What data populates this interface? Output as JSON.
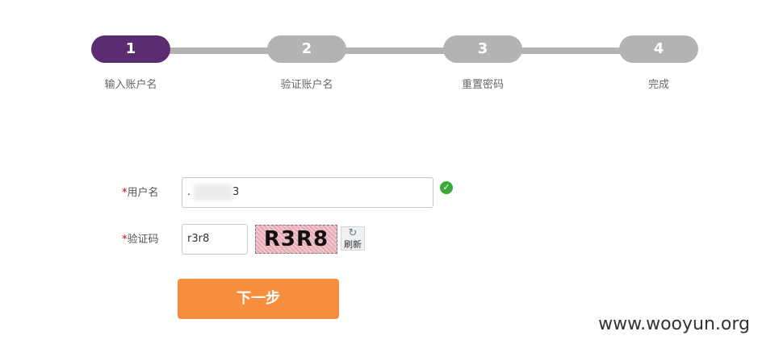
{
  "steps": [
    {
      "number": "1",
      "label": "输入账户名",
      "active": true
    },
    {
      "number": "2",
      "label": "验证账户名",
      "active": false
    },
    {
      "number": "3",
      "label": "重置密码",
      "active": false
    },
    {
      "number": "4",
      "label": "完成",
      "active": false
    }
  ],
  "form": {
    "required_mark": "*",
    "username_label": "用户名",
    "username_value_prefix": ".",
    "username_value_suffix": "3",
    "captcha_label": "验证码",
    "captcha_value": "r3r8",
    "captcha_image_text": "R3R8",
    "refresh_icon": "refresh-icon",
    "refresh_label": "刷新",
    "valid_icon": "check-circle-icon"
  },
  "next_button_label": "下一步",
  "watermark": "www.wooyun.org",
  "colors": {
    "active_step": "#5b2c6f",
    "inactive_step": "#b3b3b3",
    "primary_button": "#f78e3d",
    "valid": "#3aaa35",
    "required": "#cc0000"
  }
}
